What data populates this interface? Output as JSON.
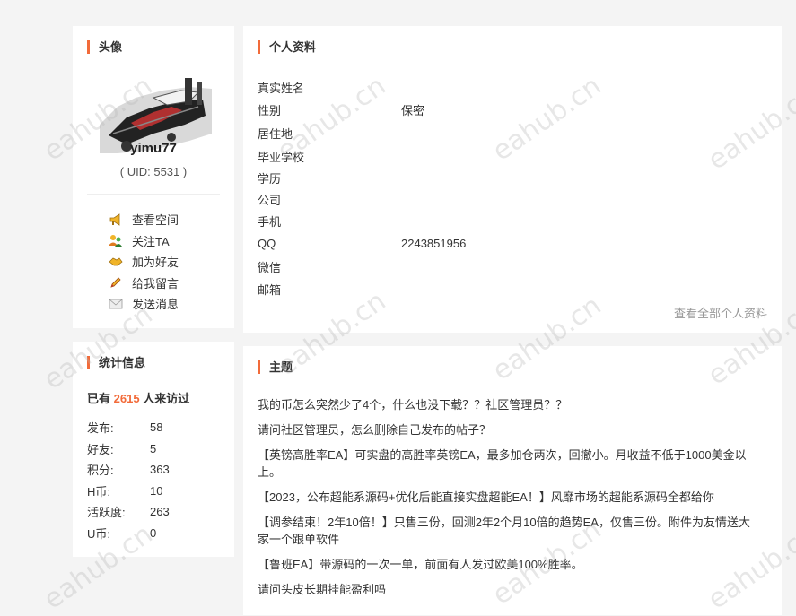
{
  "avatar_section": {
    "title": "头像",
    "username": "yimu77",
    "uid": "( UID: 5531 )",
    "actions": [
      {
        "label": "查看空间",
        "icon": "megaphone-icon"
      },
      {
        "label": "关注TA",
        "icon": "users-icon"
      },
      {
        "label": "加为好友",
        "icon": "handshake-icon"
      },
      {
        "label": "给我留言",
        "icon": "pencil-icon"
      },
      {
        "label": "发送消息",
        "icon": "envelope-icon"
      }
    ]
  },
  "stats_section": {
    "title": "统计信息",
    "visits_prefix": "已有",
    "visits_count": "2615",
    "visits_suffix": "人来访过",
    "items": [
      {
        "key": "发布:",
        "value": "58"
      },
      {
        "key": "好友:",
        "value": "5"
      },
      {
        "key": "积分:",
        "value": "363"
      },
      {
        "key": "H币:",
        "value": "10"
      },
      {
        "key": "活跃度:",
        "value": "263"
      },
      {
        "key": "U币:",
        "value": "0"
      }
    ]
  },
  "profile_section": {
    "title": "个人资料",
    "rows": [
      {
        "key": "真实姓名",
        "value": ""
      },
      {
        "key": "性别",
        "value": "保密"
      },
      {
        "key": "居住地",
        "value": ""
      },
      {
        "key": "毕业学校",
        "value": ""
      },
      {
        "key": "学历",
        "value": ""
      },
      {
        "key": "公司",
        "value": ""
      },
      {
        "key": "手机",
        "value": ""
      },
      {
        "key": "QQ",
        "value": "2243851956"
      },
      {
        "key": "微信",
        "value": ""
      },
      {
        "key": "邮箱",
        "value": ""
      }
    ],
    "view_all": "查看全部个人资料"
  },
  "topics_section": {
    "title": "主题",
    "items": [
      "我的币怎么突然少了4个，什么也没下载？？社区管理员？？",
      "请问社区管理员，怎么删除自己发布的帖子？",
      "【英镑高胜率EA】可实盘的高胜率英镑EA，最多加仓两次，回撤小。月收益不低于1000美金以上。",
      "【2023，公布超能系源码+优化后能直接实盘超能EA！】风靡市场的超能系源码全都给你",
      "【调参结束！2年10倍！】只售三份，回测2年2个月10倍的趋势EA，仅售三份。附件为友情送大家一个跟单软件",
      "【鲁班EA】带源码的一次一单，前面有人发过欧美100%胜率。",
      "请问头皮长期挂能盈利吗"
    ]
  },
  "watermark": "eahub.cn",
  "colors": {
    "accent": "#f26b3a",
    "background": "#f4f4f4"
  }
}
